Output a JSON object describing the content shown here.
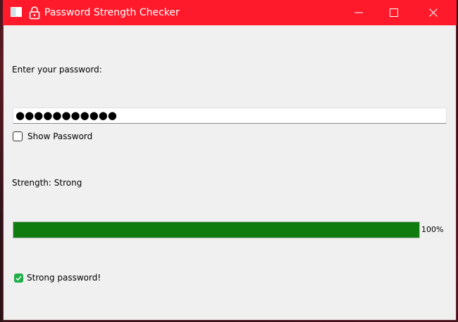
{
  "window": {
    "title": "Password Strength Checker",
    "app_icon": "window-app-icon",
    "title_icon": "padlock-icon",
    "controls": [
      "minimize",
      "maximize",
      "close"
    ],
    "titlebar_color": "#ff1a2b"
  },
  "form": {
    "prompt_label": "Enter your password:",
    "password_value": "●●●●●●●●●●●",
    "show_password": {
      "label": "Show Password",
      "checked": false
    }
  },
  "strength": {
    "text": "Strength: Strong",
    "percent": 100,
    "percent_label": "100%",
    "bar_color": "#107c10"
  },
  "verdict": {
    "icon": "check-icon",
    "label": "Strong password!",
    "icon_color": "#1fae4a"
  }
}
